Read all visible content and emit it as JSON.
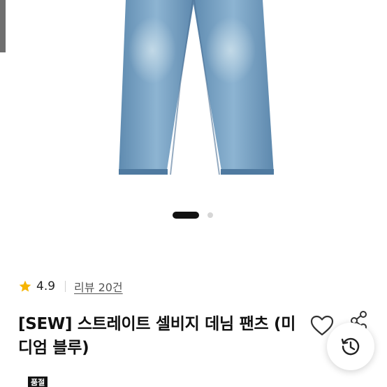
{
  "product": {
    "image_alt": "jeans-image",
    "rating": "4.9",
    "review_link": "리뷰 20건",
    "title": "[SEW] 스트레이트 셀비지 데님 팬츠 (미디엄 블루)",
    "status_badge": "품절"
  },
  "carousel": {
    "total": 2,
    "active_index": 1
  },
  "icons": {
    "rating": "star-icon",
    "wishlist": "heart-icon",
    "share": "share-icon",
    "recent_history": "history-icon"
  },
  "colors": {
    "star": "#f6b400",
    "denim": "#7aa4c4",
    "badge": "#111111"
  }
}
